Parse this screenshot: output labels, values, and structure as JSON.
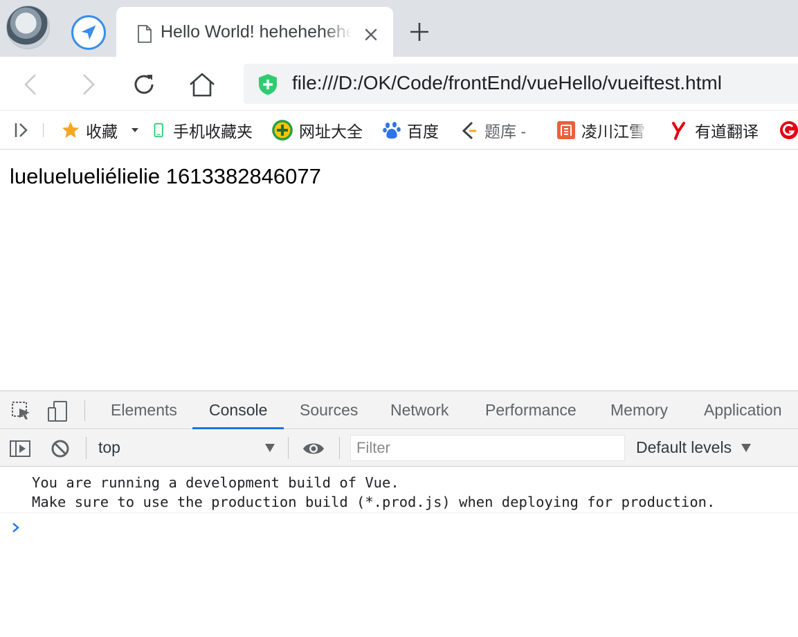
{
  "tab": {
    "title": "Hello World! hehehehehe",
    "close_icon": "close-icon",
    "new_tab_icon": "plus-icon"
  },
  "toolbar": {
    "url": "file:///D:/OK/Code/frontEnd/vueHello/vueiftest.html",
    "security_icon": "shield-plus-icon"
  },
  "bookmarks": {
    "items": [
      {
        "label": "收藏",
        "icon": "star-icon"
      },
      {
        "label": "手机收藏夹",
        "icon": "phone-icon"
      },
      {
        "label": "网址大全",
        "icon": "plus-circle-icon"
      },
      {
        "label": "百度",
        "icon": "baidu-paw-icon"
      },
      {
        "label": "题库 -",
        "icon": "tiku-icon"
      },
      {
        "label": "凌川江雪",
        "icon": "jian-icon"
      },
      {
        "label": "有道翻译",
        "icon": "youdao-icon"
      }
    ]
  },
  "page": {
    "text": "lueluelueliélielie 1613382846077"
  },
  "devtools": {
    "tabs": [
      "Elements",
      "Console",
      "Sources",
      "Network",
      "Performance",
      "Memory",
      "Application"
    ],
    "active_tab": "Console",
    "context": "top",
    "filter_placeholder": "Filter",
    "levels": "Default levels",
    "messages": [
      "You are running a development build of Vue.",
      "Make sure to use the production build (*.prod.js) when deploying for production."
    ]
  },
  "colors": {
    "accent": "#1a73e8",
    "tabstrip": "#dee1e6",
    "devtools_bar": "#f3f3f3"
  }
}
